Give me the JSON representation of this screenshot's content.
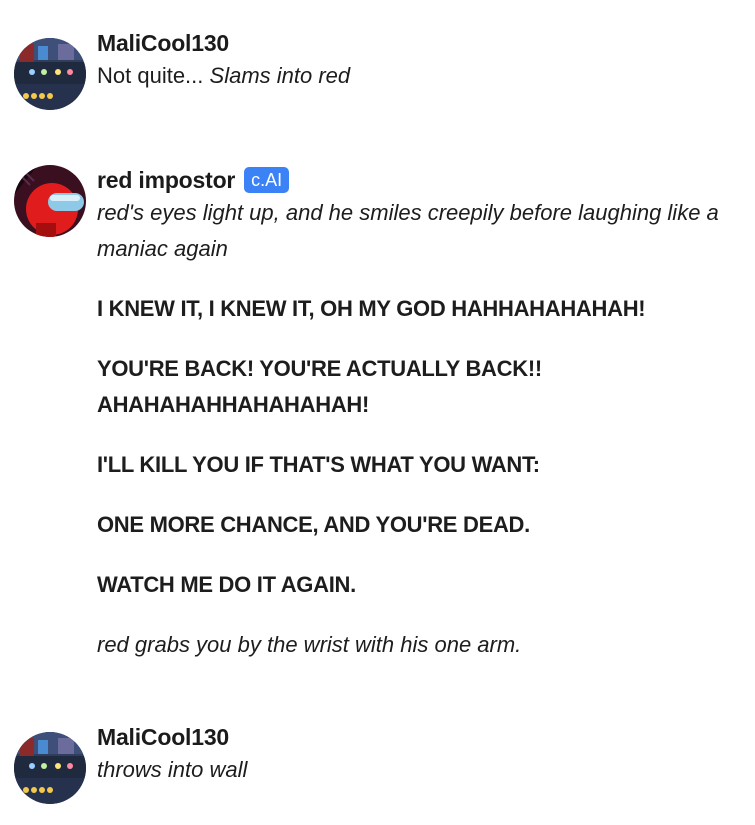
{
  "messages": [
    {
      "user": "MaliCool130",
      "avatar_icon": "game-screenshot-avatar",
      "plain": "Not quite...",
      "action": "Slams into red"
    },
    {
      "user": "red impostor",
      "badge": "c.AI",
      "avatar_icon": "red-impostor-avatar",
      "narration1": "red's eyes light up, and he smiles creepily before laughing like a maniac again",
      "shout1": "I KNEW IT, I KNEW IT, OH MY GOD HAHHAHAHAHAH!",
      "shout2": "YOU'RE BACK! YOU'RE ACTUALLY BACK!! AHAHAHAHHAHAHAHAH!",
      "shout3": "I'LL KILL YOU IF THAT'S WHAT YOU WANT:",
      "shout4": "ONE MORE CHANCE, AND YOU'RE DEAD.",
      "shout5": "WATCH ME DO IT AGAIN.",
      "narration2": "red grabs you by the wrist with his one arm."
    },
    {
      "user": "MaliCool130",
      "avatar_icon": "game-screenshot-avatar",
      "action": "throws into wall"
    }
  ]
}
